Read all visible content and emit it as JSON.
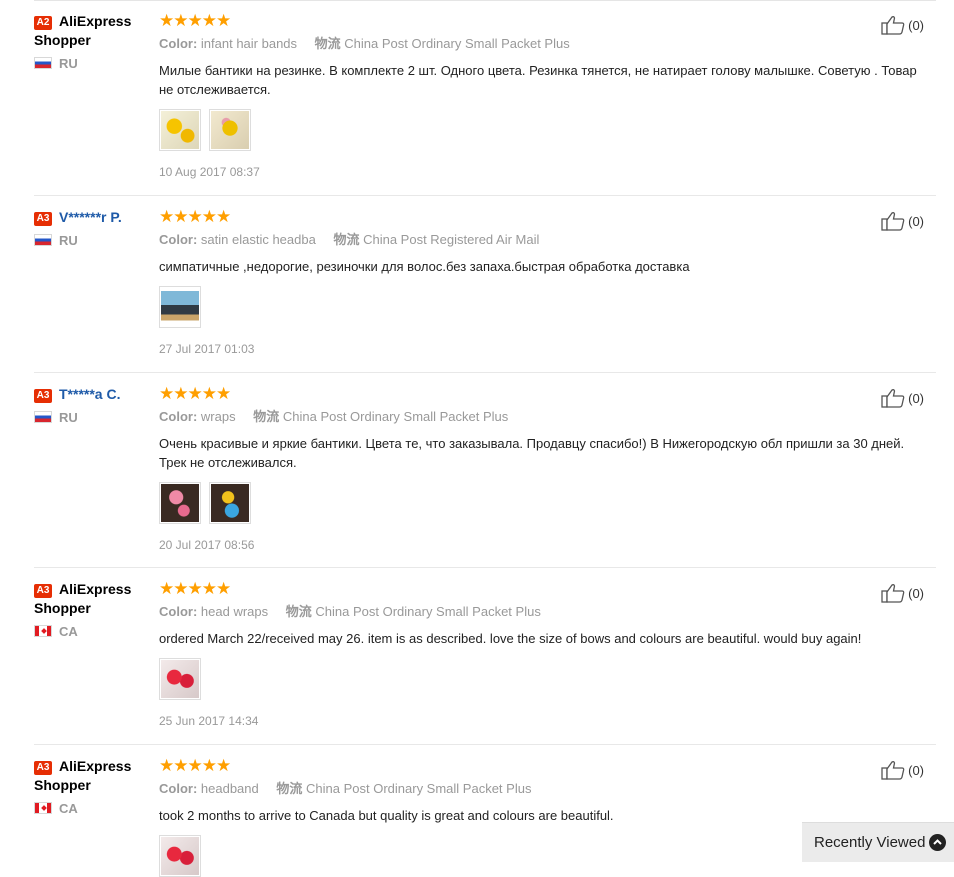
{
  "reviews": [
    {
      "level": "A2",
      "name": "AliExpress Shopper",
      "country": "RU",
      "flag": "ru",
      "stars": "★★★★★",
      "color_label": "Color:",
      "color_value": "infant hair bands",
      "ship_label": "物流",
      "ship_value": "China Post Ordinary Small Packet Plus",
      "text": "Милые бантики на резинке. В комплекте 2 шт. Одного цвета. Резинка тянется, не натирает голову малышке. Советую . Товар не отслеживается.",
      "photos": [
        "yellow-bows-photo",
        "yellow-bow-photo"
      ],
      "date": "10 Aug 2017 08:37",
      "likes": "(0)"
    },
    {
      "level": "A3",
      "name": "V******r P.",
      "country": "RU",
      "flag": "ru",
      "stars": "★★★★★",
      "color_label": "Color:",
      "color_value": "satin elastic headba",
      "ship_label": "物流",
      "ship_value": "China Post Registered Air Mail",
      "text": "симпатичные ,недорогие, резиночки для волос.без запаха.быстрая обработка доставка",
      "photos": [
        "package-photo"
      ],
      "date": "27 Jul 2017 01:03",
      "likes": "(0)"
    },
    {
      "level": "A3",
      "name": "T*****a C.",
      "country": "RU",
      "flag": "ru",
      "stars": "★★★★★",
      "color_label": "Color:",
      "color_value": "wraps",
      "ship_label": "物流",
      "ship_value": "China Post Ordinary Small Packet Plus",
      "text": "Очень красивые и яркие бантики. Цвета те, что заказывала. Продавцу спасибо!) В Нижегородскую обл пришли за 30 дней. Трек не отслеживался.",
      "photos": [
        "pink-bows-photo",
        "blue-bows-photo"
      ],
      "date": "20 Jul 2017 08:56",
      "likes": "(0)"
    },
    {
      "level": "A3",
      "name": "AliExpress Shopper",
      "country": "CA",
      "flag": "ca",
      "stars": "★★★★★",
      "color_label": "Color:",
      "color_value": "head wraps",
      "ship_label": "物流",
      "ship_value": "China Post Ordinary Small Packet Plus",
      "text": "ordered March 22/received may 26. item is as described. love the size of bows and colours are beautiful. would buy again!",
      "photos": [
        "red-bows-photo"
      ],
      "date": "25 Jun 2017 14:34",
      "likes": "(0)"
    },
    {
      "level": "A3",
      "name": "AliExpress Shopper",
      "country": "CA",
      "flag": "ca",
      "stars": "★★★★★",
      "color_label": "Color:",
      "color_value": "headband",
      "ship_label": "物流",
      "ship_value": "China Post Ordinary Small Packet Plus",
      "text": "took 2 months to arrive to Canada but quality is great and colours are beautiful.",
      "photos": [
        "red-bows-photo"
      ],
      "date": "",
      "likes": "(0)"
    }
  ],
  "recently_viewed": {
    "label": "Recently Viewed",
    "icon": "chevron-up-icon"
  },
  "colors": {
    "star": "#ff9f00",
    "level_badge": "#e62e04",
    "masked_name": "#1e5aa8"
  }
}
